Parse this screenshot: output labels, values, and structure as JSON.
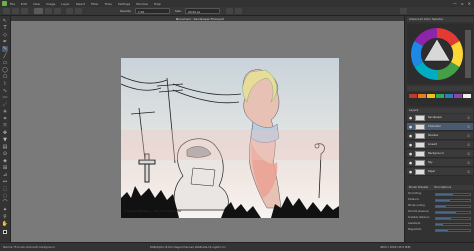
{
  "menubar": {
    "items": [
      "File",
      "Edit",
      "View",
      "Image",
      "Layer",
      "Select",
      "Filter",
      "Tools",
      "Settings",
      "Window",
      "Help"
    ]
  },
  "window_controls": {
    "minimize": "—",
    "maximize": "▫",
    "close": "✕"
  },
  "tool_options": {
    "opacity_label": "Opacity:",
    "opacity_value": "1.00",
    "size_label": "Size:",
    "size_value": "20.00 px"
  },
  "document": {
    "tab_title": "Unnamed - Sandpaper-Final.psd",
    "credit_text": "© Sabrina Miltenberg — Krita 3.0 Artbook cover"
  },
  "docker": {
    "color_panel_title": "Advanced Color Selector",
    "layers_panel_title": "Layers",
    "layers_blend_mode": "Normal",
    "layers_opacity": "Opacity: 100%",
    "layers": [
      {
        "name": "Sandpaper",
        "active": false
      },
      {
        "name": "Character",
        "active": true
      },
      {
        "name": "Shadow",
        "active": false
      },
      {
        "name": "Lineart",
        "active": false
      },
      {
        "name": "Background",
        "active": false
      },
      {
        "name": "Sky",
        "active": false
      },
      {
        "name": "Paper",
        "active": false
      }
    ],
    "brush_tabs": [
      "Brush Presets",
      "Tool Options"
    ],
    "brush_options": [
      {
        "label": "Smoothing:",
        "value": 0.5
      },
      {
        "label": "Distance:",
        "value": 0.4
      },
      {
        "label": "Stroke ending:",
        "value": 0.3
      },
      {
        "label": "Smooth pressure:",
        "value": 0.6
      },
      {
        "label": "Scalable distance:",
        "value": 0.45
      },
      {
        "label": "Assistants:",
        "value": 0.2
      },
      {
        "label": "Magnetism:",
        "value": 0.35
      }
    ]
  },
  "status": {
    "left": "Normal 75 brush (Airbrush) background",
    "center": "RGB/Alpha (8-bit integer/channel) sRGB-elle-V2-srgbtrc.icc",
    "right": "4000 x 3000 (45.8 MiB)"
  },
  "colors": {
    "accent": "#4a5a70",
    "canvas_bg": "#7a7a7a",
    "panel_bg": "#323232"
  }
}
